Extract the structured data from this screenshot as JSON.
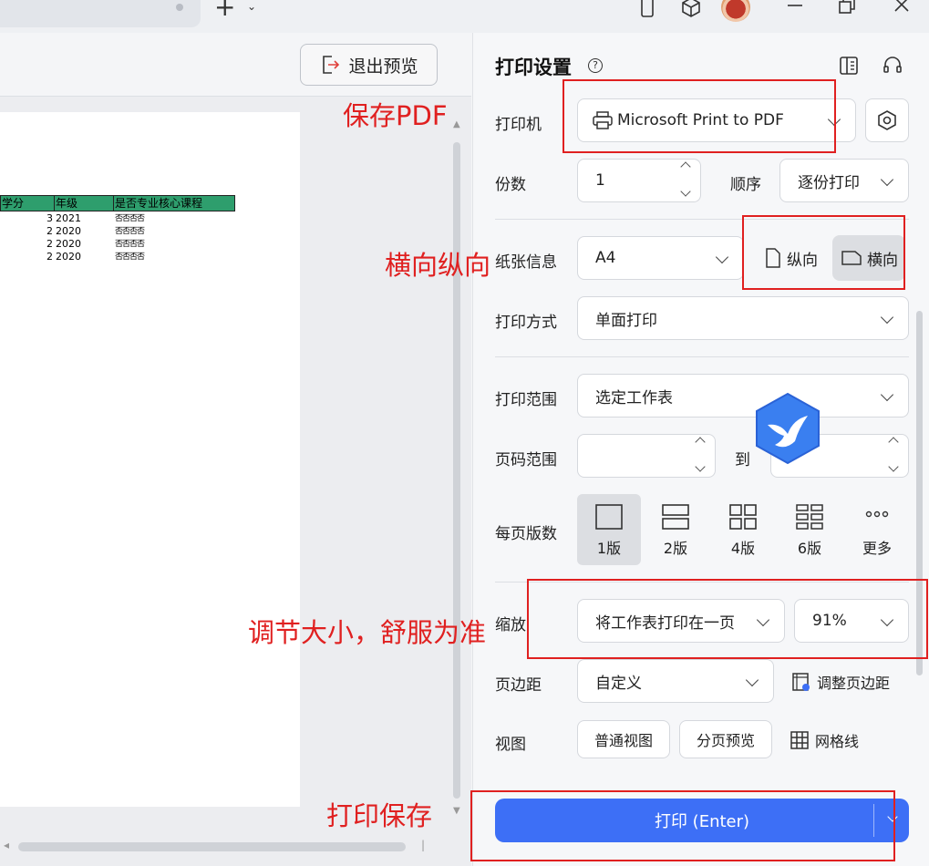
{
  "titlebar": {
    "icons": [
      "plus-icon",
      "chevron-down-icon",
      "phone-icon",
      "cube-icon",
      "avatar",
      "minimize-icon",
      "restore-icon",
      "close-icon"
    ]
  },
  "preview": {
    "exit_label": "退出预览",
    "sheet": {
      "headers": [
        "学分",
        "年级",
        "是否专业核心课程"
      ],
      "rows": [
        {
          "credit": "3",
          "year": "2021",
          "core": "否否否否"
        },
        {
          "credit": "2",
          "year": "2020",
          "core": "否否否否"
        },
        {
          "credit": "2",
          "year": "2020",
          "core": "否否否否"
        },
        {
          "credit": "2",
          "year": "2020",
          "core": "否否否否"
        }
      ]
    }
  },
  "panel": {
    "title": "打印设置",
    "printer_label": "打印机",
    "printer_value": "Microsoft Print to PDF",
    "copies_label": "份数",
    "copies_value": "1",
    "order_label": "顺序",
    "order_value": "逐份打印",
    "paper_label": "纸张信息",
    "paper_value": "A4",
    "portrait_label": "纵向",
    "landscape_label": "横向",
    "method_label": "打印方式",
    "method_value": "单面打印",
    "range_label": "打印范围",
    "range_value": "选定工作表",
    "pages_label": "页码范围",
    "pages_to": "到",
    "per_page_label": "每页版数",
    "layouts": [
      "1版",
      "2版",
      "4版",
      "6版",
      "更多"
    ],
    "scale_label": "缩放",
    "scale_mode": "将工作表打印在一页",
    "scale_percent": "91%",
    "margin_label": "页边距",
    "margin_value": "自定义",
    "adjust_margin": "调整页边距",
    "view_label": "视图",
    "normal_view": "普通视图",
    "page_break_preview": "分页预览",
    "gridlines": "网格线",
    "print_button": "打印 (Enter)"
  },
  "annotations": {
    "save_pdf": "保存PDF",
    "orientation": "横向纵向",
    "scale_tip": "调节大小，舒服为准",
    "print_save": "打印保存",
    "color": "#e02020"
  },
  "colors": {
    "accent": "#3d6ff6",
    "sheet_header": "#2e9e6d",
    "annotation": "#e02020"
  }
}
